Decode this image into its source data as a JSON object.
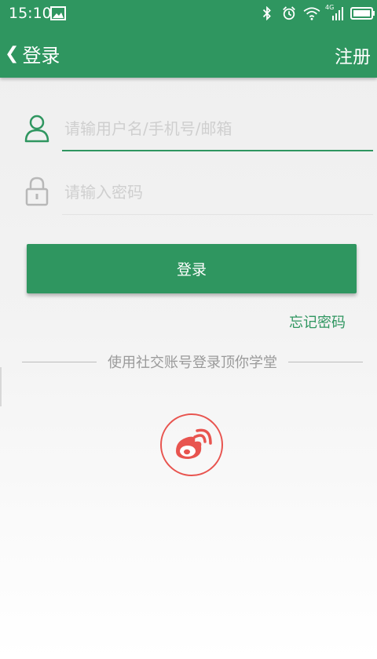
{
  "status_bar": {
    "time": "15:10",
    "network_label": "4G"
  },
  "app_bar": {
    "title": "登录",
    "register_label": "注册"
  },
  "form": {
    "username_placeholder": "请输用户名/手机号/邮箱",
    "password_placeholder": "请输入密码",
    "login_label": "登录",
    "forgot_label": "忘记密码"
  },
  "social": {
    "divider_text": "使用社交账号登录顶你学堂"
  },
  "colors": {
    "brand_green": "#2f9660",
    "weibo_red": "#e8544f"
  }
}
